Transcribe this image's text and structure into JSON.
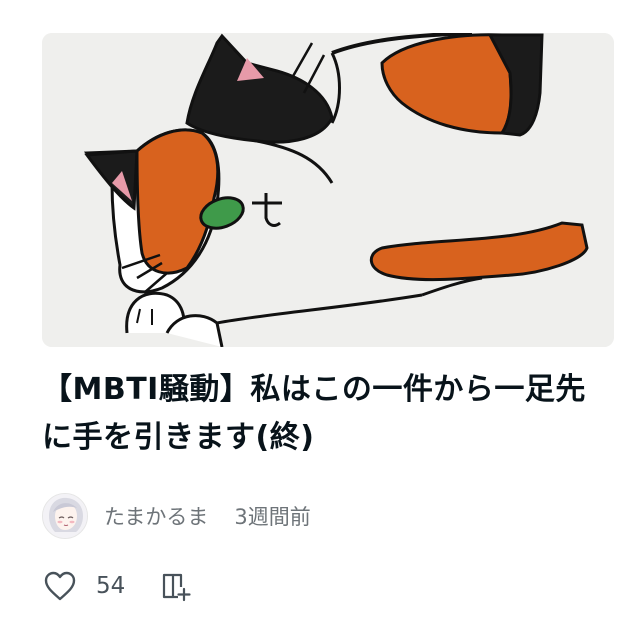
{
  "article": {
    "title": "【MBTI騒動】私はこの一件から一足先に手を引きます(終)",
    "thumbnail_icon": "calico-cat-drawing",
    "author_name": "たまかるま",
    "published": "3週間前",
    "like_count": "54"
  },
  "icons": {
    "like": "heart-outline-icon",
    "magazine": "magazine-add-icon"
  },
  "colors": {
    "text": "#08131a",
    "muted": "#6e7479",
    "cat_orange": "#d8621e",
    "cat_black": "#1b1b1b",
    "eye_green": "#3f9a4a"
  }
}
